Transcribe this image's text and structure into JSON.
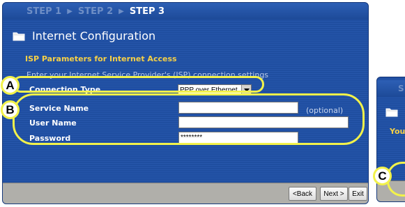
{
  "wizard": {
    "steps": [
      "STEP 1",
      "STEP 2",
      "STEP 3"
    ],
    "title": "Internet Configuration",
    "section_title": "ISP Parameters for Internet Access",
    "instruction": "Enter your Internet Service Provider's (ISP) connection settings",
    "fields": {
      "connection_type": {
        "label": "Connection Type",
        "value": "PPP over Ethernet"
      },
      "service_name": {
        "label": "Service Name",
        "value": "",
        "note": "(optional)"
      },
      "user_name": {
        "label": "User Name",
        "value": ""
      },
      "password": {
        "label": "Password",
        "value": "********"
      }
    },
    "buttons": {
      "back": "<Back",
      "next": "Next >",
      "exit": "Exit"
    }
  },
  "second_window": {
    "step_text": "S",
    "text_fragment": "You"
  },
  "callouts": [
    "A",
    "B",
    "C"
  ],
  "colors": {
    "window_blue": "#1f4ea0",
    "accent_yellow": "#f6d046",
    "callout_yellow": "#f2f24a",
    "footer_gray": "#b0afaa"
  }
}
